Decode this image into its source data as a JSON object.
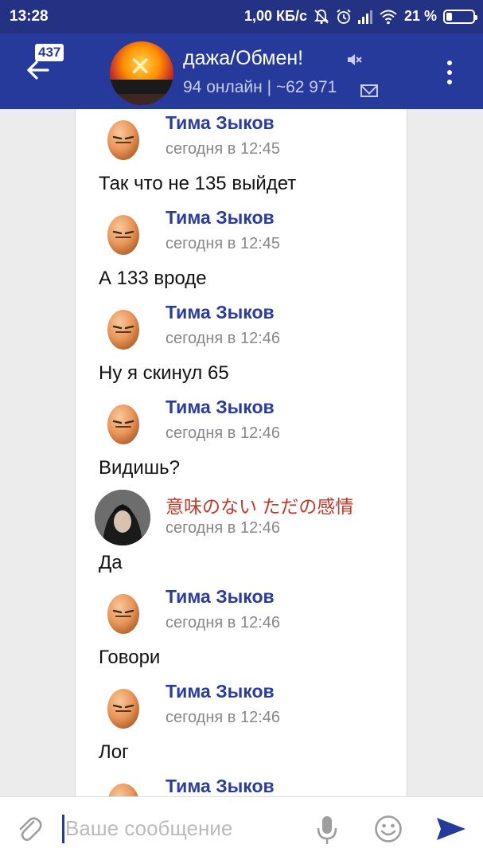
{
  "status": {
    "time": "13:28",
    "speed": "1,00 КБ/с",
    "battery": "21 %",
    "battery_level": 0.21
  },
  "appbar": {
    "badge": "437",
    "title": "дажа/Обмен!",
    "subtitle": "94 онлайн | ~62 971"
  },
  "messages": [
    {
      "author": "Тима Зыков",
      "time": "сегодня в 12:45",
      "text": "Так что не 135 выйдет",
      "avatar": "egg-icon"
    },
    {
      "author": "Тима Зыков",
      "time": "сегодня в 12:45",
      "text": "А 133 вроде",
      "avatar": "egg-icon"
    },
    {
      "author": "Тима Зыков",
      "time": "сегодня в 12:46",
      "text": "Ну я скинул 65",
      "avatar": "egg-icon"
    },
    {
      "author": "Тима Зыков",
      "time": "сегодня в 12:46",
      "text": "Видишь?",
      "avatar": "egg-icon"
    },
    {
      "author": "意味のない ただの感情",
      "time": "сегодня в 12:46",
      "text": "Да",
      "avatar": "photo",
      "author_color": "#c0392b"
    },
    {
      "author": "Тима Зыков",
      "time": "сегодня в 12:46",
      "text": "Говори",
      "avatar": "egg-icon"
    },
    {
      "author": "Тима Зыков",
      "time": "сегодня в 12:46",
      "text": "Лог",
      "avatar": "egg-icon"
    },
    {
      "author": "Тима Зыков",
      "time": "",
      "text": "",
      "avatar": "egg-icon"
    }
  ],
  "input": {
    "placeholder": "Ваше сообщение"
  },
  "colors": {
    "status_bar": "#233282",
    "app_bar": "#263a9b",
    "author_name": "#2a3ca3",
    "send": "#263a9b"
  }
}
